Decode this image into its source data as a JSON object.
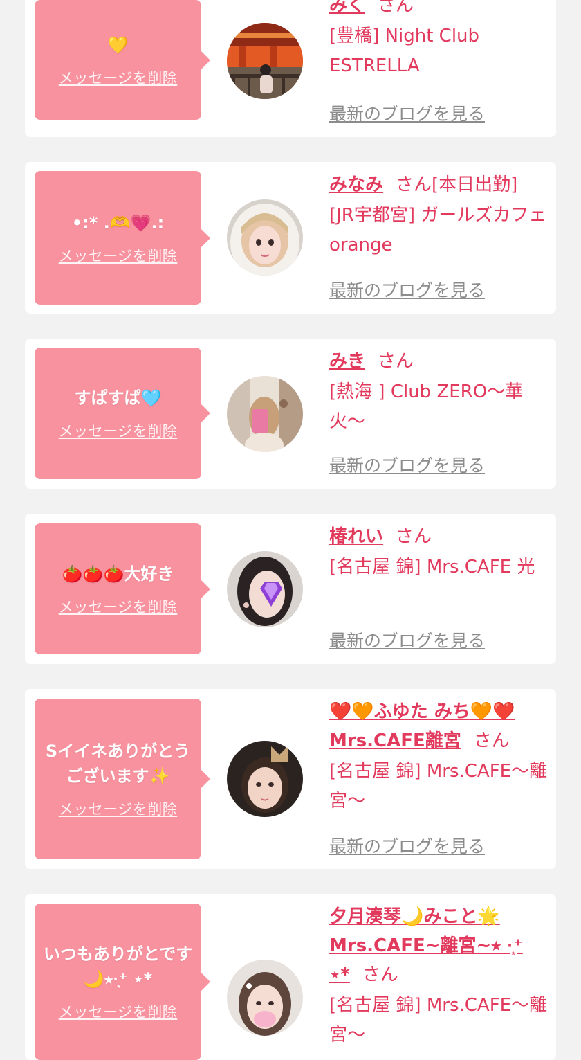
{
  "common": {
    "delete_label": "メッセージを削除",
    "blog_label": "最新のブログを見る",
    "san": "さん",
    "accent_color": "#e23a5d",
    "bubble_color": "#f8929f"
  },
  "cards": [
    {
      "message": "💛",
      "name": "みく",
      "status": "",
      "store": "[豊橋] Night Club ESTRELLA"
    },
    {
      "message": "•:* .🫶💗.:",
      "name": "みなみ",
      "status": "[本日出勤]",
      "store": "[JR宇都宮] ガールズカフェ orange"
    },
    {
      "message": "すぱすぱ🩵",
      "name": "みき",
      "status": "",
      "store": "[熱海 ] Club ZERO〜華火〜"
    },
    {
      "message": "🍅🍅🍅大好き",
      "name": "椿れい",
      "status": "",
      "store": "[名古屋 錦] Mrs.CAFE 光"
    },
    {
      "message": "Sイイネありがとうございます✨",
      "name": "❤️🧡ふゆた みち🧡❤️ Mrs.CAFE離宮",
      "status": "",
      "store": "[名古屋 錦] Mrs.CAFE〜離宮〜"
    },
    {
      "message": "いつもありがとです🌙⭑·͙⁺ ⋆*",
      "name": "夕月湊琴🌙みこと🌟 Mrs.CAFE~離宮~⭑ ·͙⁺ ⋆*",
      "status": "",
      "store": "[名古屋 錦] Mrs.CAFE〜離宮〜"
    }
  ]
}
